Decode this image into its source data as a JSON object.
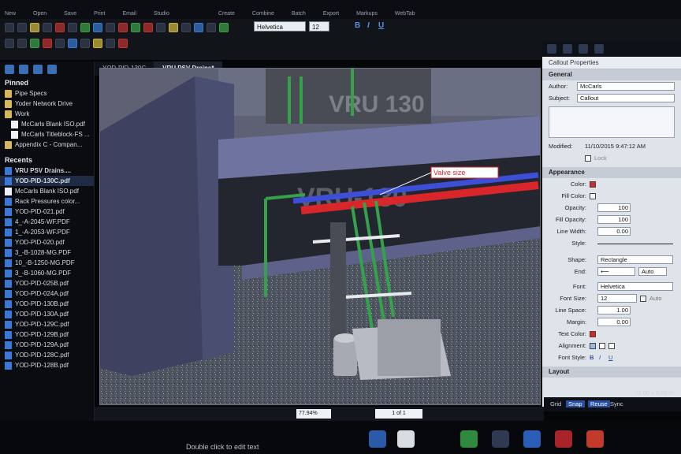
{
  "menu": [
    "New",
    "Open",
    "Save",
    "Print",
    "Email",
    "Studio",
    "Create",
    "Combine",
    "Batch",
    "Export",
    "Markups",
    "WebTab"
  ],
  "toolbar": {
    "font": "Helvetica",
    "font_size": "12",
    "bold": "B",
    "italic": "I",
    "underline": "U"
  },
  "tabs": [
    {
      "label": "YOD-PID-130C",
      "active": false
    },
    {
      "label": "VRU PSV Drains*",
      "active": true
    }
  ],
  "left_panel": {
    "pinned_header": "Pinned",
    "pinned": [
      "Pipe Specs",
      "Yoder Network Drive",
      "Work",
      "McCarls Blank ISO.pdf",
      "McCarls Titleblock-FS ...",
      "Appendix C - Compan..."
    ],
    "recents_header": "Recents",
    "recents": [
      "VRU PSV Drains....",
      "YOD-PID-130C.pdf",
      "McCarls Blank ISO.pdf",
      "Rack Pressures color...",
      "YOD-PID-021.pdf",
      "4_-A-2045-WF.PDF",
      "1_-A-2053-WF.PDF",
      "YOD-PID-020.pdf",
      "3_-B-1028-MG.PDF",
      "10_-B-1250-MG.PDF",
      "3_-B-1060-MG.PDF",
      "YOD-PID-025B.pdf",
      "YOD-PID-024A.pdf",
      "YOD-PID-130B.pdf",
      "YOD-PID-130A.pdf",
      "YOD-PID-129C.pdf",
      "YOD-PID-129B.pdf",
      "YOD-PID-129A.pdf",
      "YOD-PID-128C.pdf",
      "YOD-PID-128B.pdf"
    ]
  },
  "canvas": {
    "wall_label": "VRU 130",
    "wall_label_2": "VRU-130",
    "callout_text": "Valve size"
  },
  "properties": {
    "title": "Callout Properties",
    "general_header": "General",
    "author_label": "Author:",
    "author": "McCarls",
    "subject_label": "Subject:",
    "subject": "Callout",
    "modified_label": "Modified:",
    "modified": "11/10/2015 9:47:12 AM",
    "lock_label": "Lock",
    "appearance_header": "Appearance",
    "color_label": "Color:",
    "fill_color_label": "Fill Color:",
    "opacity_label": "Opacity:",
    "opacity": "100",
    "fill_opacity_label": "Fill Opacity:",
    "fill_opacity": "100",
    "line_width_label": "Line Width:",
    "line_width": "0.00",
    "style_label": "Style:",
    "shape_label": "Shape:",
    "shape": "Rectangle",
    "end_label": "End:",
    "end_value": "Auto",
    "font_label": "Font:",
    "font": "Helvetica",
    "font_size_label": "Font Size:",
    "font_size": "12",
    "auto_label": "Auto",
    "line_space_label": "Line Space:",
    "line_space": "1.00",
    "margin_label": "Margin:",
    "margin": "0.00",
    "text_color_label": "Text Color:",
    "alignment_label": "Alignment:",
    "font_style_label": "Font Style:",
    "layout_header": "Layout"
  },
  "status": {
    "zoom": "77.94%",
    "page": "1 of 1",
    "grid": "Grid",
    "snap": "Snap",
    "reuse": "Reuse",
    "sync": "Sync",
    "page_size": "11.00 x 8.50 in",
    "hint": "Double click to edit text"
  },
  "colors": {
    "pipe_red": "#d8262a",
    "pipe_blue": "#3d4fd6",
    "pipe_green": "#33a24a",
    "accent": "#2a4fa0"
  }
}
